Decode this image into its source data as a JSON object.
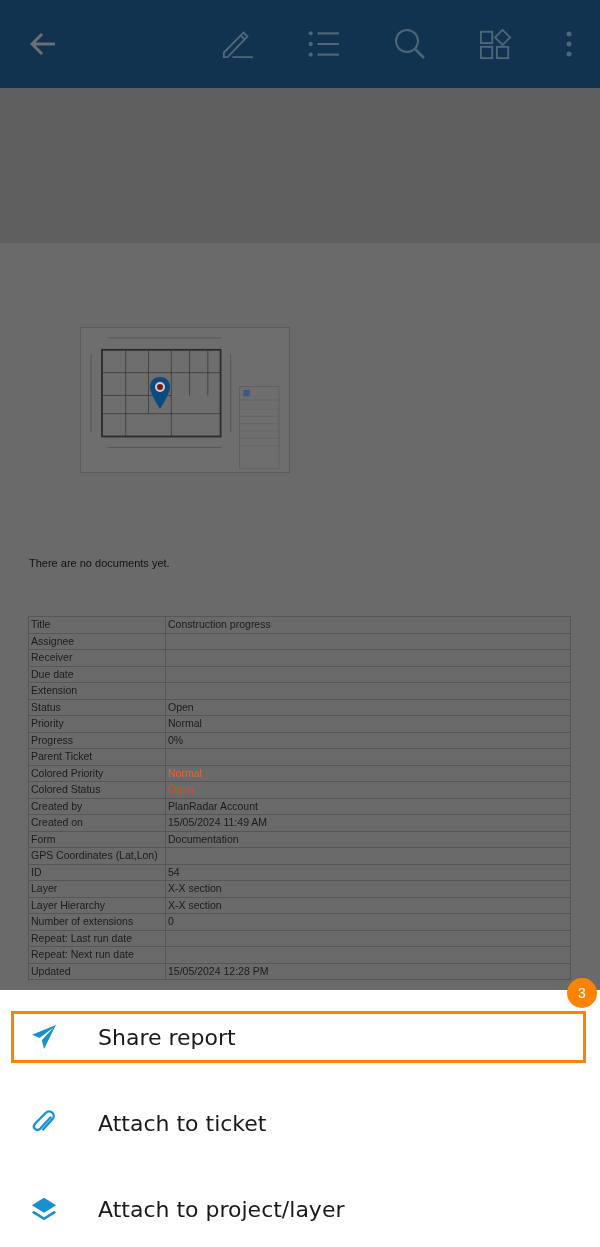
{
  "toolbar": {
    "icons": [
      {
        "kind": "back"
      },
      {
        "kind": "edit"
      },
      {
        "kind": "list"
      },
      {
        "kind": "search"
      },
      {
        "kind": "shapes"
      },
      {
        "kind": "more"
      }
    ]
  },
  "documents": {
    "empty_message": "There are no documents yet."
  },
  "table": {
    "rows": [
      {
        "label": "Title",
        "value": "Construction progress"
      },
      {
        "label": "Assignee",
        "value": ""
      },
      {
        "label": "Receiver",
        "value": ""
      },
      {
        "label": "Due date",
        "value": ""
      },
      {
        "label": "Extension",
        "value": ""
      },
      {
        "label": "Status",
        "value": "Open"
      },
      {
        "label": "Priority",
        "value": "Normal"
      },
      {
        "label": "Progress",
        "value": "0%"
      },
      {
        "label": "Parent Ticket",
        "value": ""
      },
      {
        "label": "Colored Priority",
        "value": "Normal",
        "color": "#e8643a"
      },
      {
        "label": "Colored Status",
        "value": "Open",
        "color": "#e04a1c"
      },
      {
        "label": "Created by",
        "value": "PlanRadar Account"
      },
      {
        "label": "Created on",
        "value": "15/05/2024 11:49 AM"
      },
      {
        "label": "Form",
        "value": "Documentation"
      },
      {
        "label": "GPS Coordinates (Lat,Lon)",
        "value": ""
      },
      {
        "label": "ID",
        "value": "54"
      },
      {
        "label": "Layer",
        "value": "X-X section"
      },
      {
        "label": "Layer Hierarchy",
        "value": "X-X section"
      },
      {
        "label": "Number of extensions",
        "value": "0"
      },
      {
        "label": "Repeat: Last run date",
        "value": ""
      },
      {
        "label": "Repeat: Next run date",
        "value": ""
      },
      {
        "label": "Updated",
        "value": "15/05/2024 12:28 PM"
      }
    ]
  },
  "sheet": {
    "items": [
      {
        "kind": "share",
        "label": "Share report",
        "highlighted": true,
        "badge": "3"
      },
      {
        "kind": "attach",
        "label": "Attach to ticket",
        "highlighted": false
      },
      {
        "kind": "layers",
        "label": "Attach to project/layer",
        "highlighted": false
      }
    ]
  }
}
